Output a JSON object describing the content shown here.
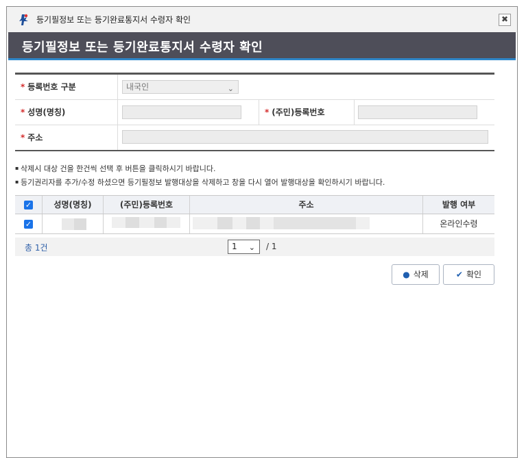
{
  "window": {
    "title": "등기필정보 또는 등기완료통지서 수령자 확인",
    "close_label": "✖"
  },
  "header": {
    "title": "등기필정보 또는 등기완료통지서 수령자 확인"
  },
  "form": {
    "reg_type_label": "등록번호 구분",
    "reg_type_value": "내국인",
    "name_label": "성명(명칭)",
    "id_label": "(주민)등록번호",
    "address_label": "주소",
    "required_mark": "*"
  },
  "notes": [
    "삭제시 대상 건을 한건씩 선택 후 버튼을 클릭하시기 바랍니다.",
    "등기권리자를 추가/수정 하셨으면 등기필정보 발행대상을 삭제하고 창을 다시 열어 발행대상을 확인하시기 바랍니다."
  ],
  "table": {
    "headers": [
      "성명(명칭)",
      "(주민)등록번호",
      "주소",
      "발행 여부"
    ],
    "rows": [
      {
        "checked": true,
        "issue_status": "온라인수령"
      }
    ],
    "header_checked": true
  },
  "footer": {
    "total": "총 1건",
    "page_value": "1",
    "page_total": "/ 1"
  },
  "buttons": {
    "delete_label": "삭제",
    "confirm_label": "확인"
  },
  "colors": {
    "header_bg": "#4e4e59",
    "header_accent": "#2e86c8",
    "checkbox": "#1a73e8",
    "required": "#d42d2d"
  }
}
